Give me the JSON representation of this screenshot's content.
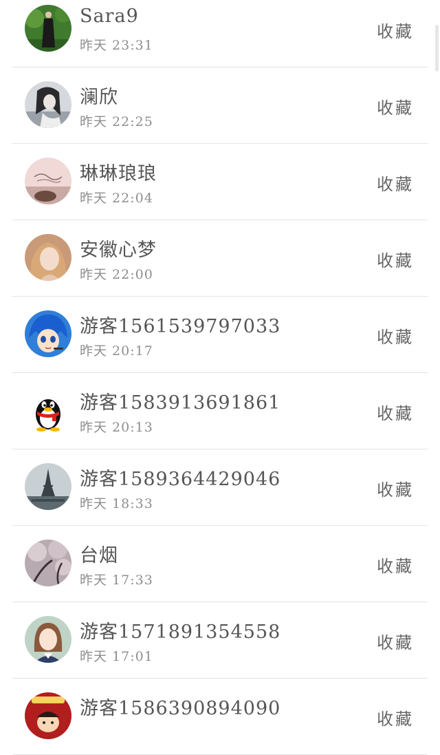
{
  "contacts": [
    {
      "name": "Sara9",
      "time": "昨天 23:31",
      "action": "收藏",
      "avatar": "woman-in-garden-avatar"
    },
    {
      "name": "澜欣",
      "time": "昨天 22:25",
      "action": "收藏",
      "avatar": "grayscale-girl-avatar"
    },
    {
      "name": "琳琳琅琅",
      "time": "昨天 22:04",
      "action": "收藏",
      "avatar": "pink-special-text-avatar"
    },
    {
      "name": "安徽心梦",
      "time": "昨天 22:00",
      "action": "收藏",
      "avatar": "blonde-woman-avatar"
    },
    {
      "name": "游客1561539797033",
      "time": "昨天 20:17",
      "action": "收藏",
      "avatar": "blue-hair-anime-avatar"
    },
    {
      "name": "游客1583913691861",
      "time": "昨天 20:13",
      "action": "收藏",
      "avatar": "qq-penguin-avatar"
    },
    {
      "name": "游客1589364429046",
      "time": "昨天 18:33",
      "action": "收藏",
      "avatar": "eiffel-tower-avatar"
    },
    {
      "name": "台烟",
      "time": "昨天 17:33",
      "action": "收藏",
      "avatar": "cherry-blossom-avatar"
    },
    {
      "name": "游客1571891354558",
      "time": "昨天 17:01",
      "action": "收藏",
      "avatar": "girl-in-uniform-avatar"
    },
    {
      "name": "游客1586390894090",
      "time": "",
      "action": "收藏",
      "avatar": "red-cartoon-avatar"
    }
  ]
}
